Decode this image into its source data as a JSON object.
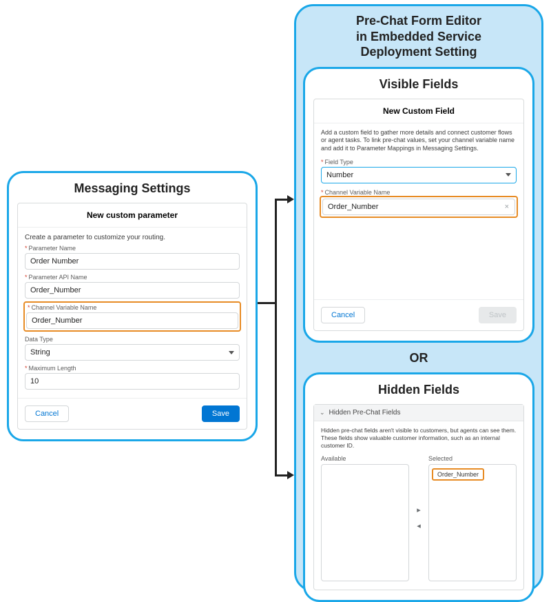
{
  "rightHeader": "Pre-Chat Form Editor\nin Embedded Service\nDeployment Setting",
  "visible": {
    "title": "Visible Fields",
    "panelHeader": "New Custom Field",
    "desc": "Add a custom field to gather more details and connect customer flows or agent tasks. To link pre-chat values, set your channel variable name and add it to Parameter Mappings in Messaging Settings.",
    "fieldTypeLabel": "Field Type",
    "fieldTypeValue": "Number",
    "channelVarLabel": "Channel Variable Name",
    "channelVarValue": "Order_Number",
    "cancel": "Cancel",
    "save": "Save"
  },
  "orLabel": "OR",
  "hidden": {
    "title": "Hidden Fields",
    "sectionHeader": "Hidden Pre-Chat Fields",
    "desc": "Hidden pre-chat fields aren't visible to customers, but agents can see them. These fields show valuable customer information, such as an internal customer ID.",
    "availableLabel": "Available",
    "selectedLabel": "Selected",
    "selectedItem": "Order_Number"
  },
  "left": {
    "title": "Messaging Settings",
    "panelHeader": "New custom parameter",
    "desc": "Create a parameter to customize your routing.",
    "paramNameLabel": "Parameter Name",
    "paramNameValue": "Order Number",
    "paramApiLabel": "Parameter API Name",
    "paramApiValue": "Order_Number",
    "channelVarLabel": "Channel Variable Name",
    "channelVarValue": "Order_Number",
    "dataTypeLabel": "Data Type",
    "dataTypeValue": "String",
    "maxLenLabel": "Maximum Length",
    "maxLenValue": "10",
    "cancel": "Cancel",
    "save": "Save"
  }
}
